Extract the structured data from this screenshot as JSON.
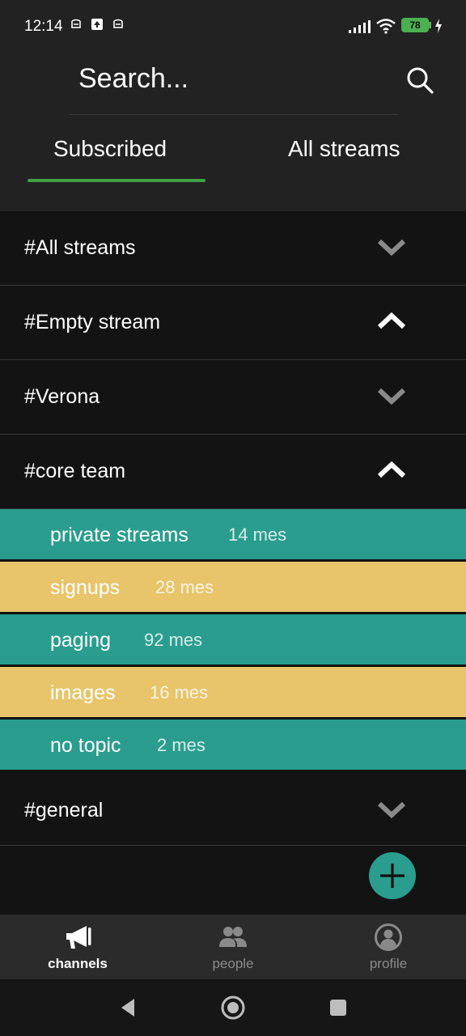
{
  "status_bar": {
    "time": "12:14",
    "battery": "78",
    "icons": [
      "sim-icon",
      "upload-icon",
      "sim-icon",
      "signal-icon",
      "wifi-icon",
      "battery-icon",
      "charging-icon"
    ]
  },
  "header": {
    "search_label": "Search...",
    "tabs": [
      {
        "label": "Subscribed",
        "active": true
      },
      {
        "label": "All streams",
        "active": false
      }
    ]
  },
  "colors": {
    "accent_green": "#3fa142",
    "topic_teal": "#2a9d8f",
    "topic_yellow": "#e8c46a",
    "background": "#131313"
  },
  "streams": [
    {
      "name": "#All streams",
      "expanded": false
    },
    {
      "name": "#Empty stream",
      "expanded": true
    },
    {
      "name": "#Verona",
      "expanded": false
    },
    {
      "name": "#core team",
      "expanded": true
    },
    {
      "name": "#general",
      "expanded": false
    }
  ],
  "topics": [
    {
      "name": "private streams",
      "count": "14 mes",
      "color": "teal"
    },
    {
      "name": "signups",
      "count": "28 mes",
      "color": "yellow"
    },
    {
      "name": "paging",
      "count": "92 mes",
      "color": "teal"
    },
    {
      "name": "images",
      "count": "16 mes",
      "color": "yellow"
    },
    {
      "name": "no topic",
      "count": "2 mes",
      "color": "teal"
    }
  ],
  "bottom_nav": [
    {
      "label": "channels",
      "icon": "megaphone-icon",
      "active": true
    },
    {
      "label": "people",
      "icon": "people-icon",
      "active": false
    },
    {
      "label": "profile",
      "icon": "profile-icon",
      "active": false
    }
  ]
}
